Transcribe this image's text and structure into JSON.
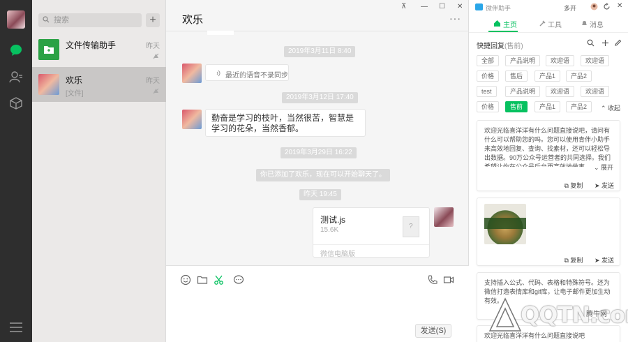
{
  "window": {
    "controls": [
      "⊼",
      "—",
      "☐",
      "✕"
    ]
  },
  "nav": {
    "icons": [
      "chat-icon",
      "contacts-icon",
      "favorites-cube-icon",
      "menu-icon"
    ]
  },
  "search": {
    "placeholder": "搜索"
  },
  "conversations": [
    {
      "name": "文件传输助手",
      "time": "昨天",
      "preview": "",
      "muted": true
    },
    {
      "name": "欢乐",
      "time": "昨天",
      "preview": "[文件]",
      "muted": true
    }
  ],
  "chat": {
    "title": "欢乐",
    "more": "···",
    "timestamps": [
      "2019年3月11日 8:40",
      "2019年3月12日 17:40",
      "2019年3月29日 16:22",
      "昨天 19:45"
    ],
    "voice_text": "最近的语音不录同步",
    "message_text": "勤奋是学习的枝叶，当然很苦，智慧是学习的花朵，当然香郁。",
    "system_text": "你已添加了欢乐，现在可以开始聊天了。",
    "file": {
      "name": "测试.js",
      "size": "15.6K",
      "source": "微信电脑版",
      "icon": "?"
    },
    "send_label": "发送(S)"
  },
  "assistant": {
    "title": "微伴助手",
    "dropdown": "多开",
    "tabs": [
      "主页",
      "工具",
      "消息"
    ],
    "quick_reply_title": "快捷回复",
    "quick_reply_status": "(售前)",
    "tags": [
      [
        "全部",
        "产品说明",
        "欢迎语",
        "欢迎语"
      ],
      [
        "价格",
        "售后",
        "产品1",
        "产品2"
      ],
      [
        "test",
        "产品说明",
        "欢迎语",
        "欢迎语"
      ],
      [
        "价格",
        "售前",
        "产品1",
        "产品2"
      ]
    ],
    "active_tag": "售前",
    "collapse_label": "收起",
    "cards": [
      {
        "text": "欢迎光临喜洋洋有什么问题直接说吧，请问有什么可以帮助您的吗。您可以使用青伴小助手来高效地回复、查询、找素材，还可以轻松导出数据。90万公众号运营者的共同选择。我们希望让你在公众号后台更高效地做事。",
        "expand": "展开"
      },
      {
        "text": ""
      },
      {
        "text": "支持插入公式、代码、表格和特殊符号。还为微信打造表情库和gif库，让电子邮件更加生动有效。"
      },
      {
        "text": "欢迎光临喜洋洋有什么问题直接说吧"
      }
    ],
    "copy_label": "复制",
    "send_label": "发送"
  },
  "watermark": {
    "brand": "QQTN.com",
    "cn": "腾牛网"
  },
  "colors": {
    "accent": "#07c160",
    "nav_bg": "#2e2e2e",
    "list_bg": "#ebe9e8",
    "chat_bg": "#f5f5f5"
  }
}
